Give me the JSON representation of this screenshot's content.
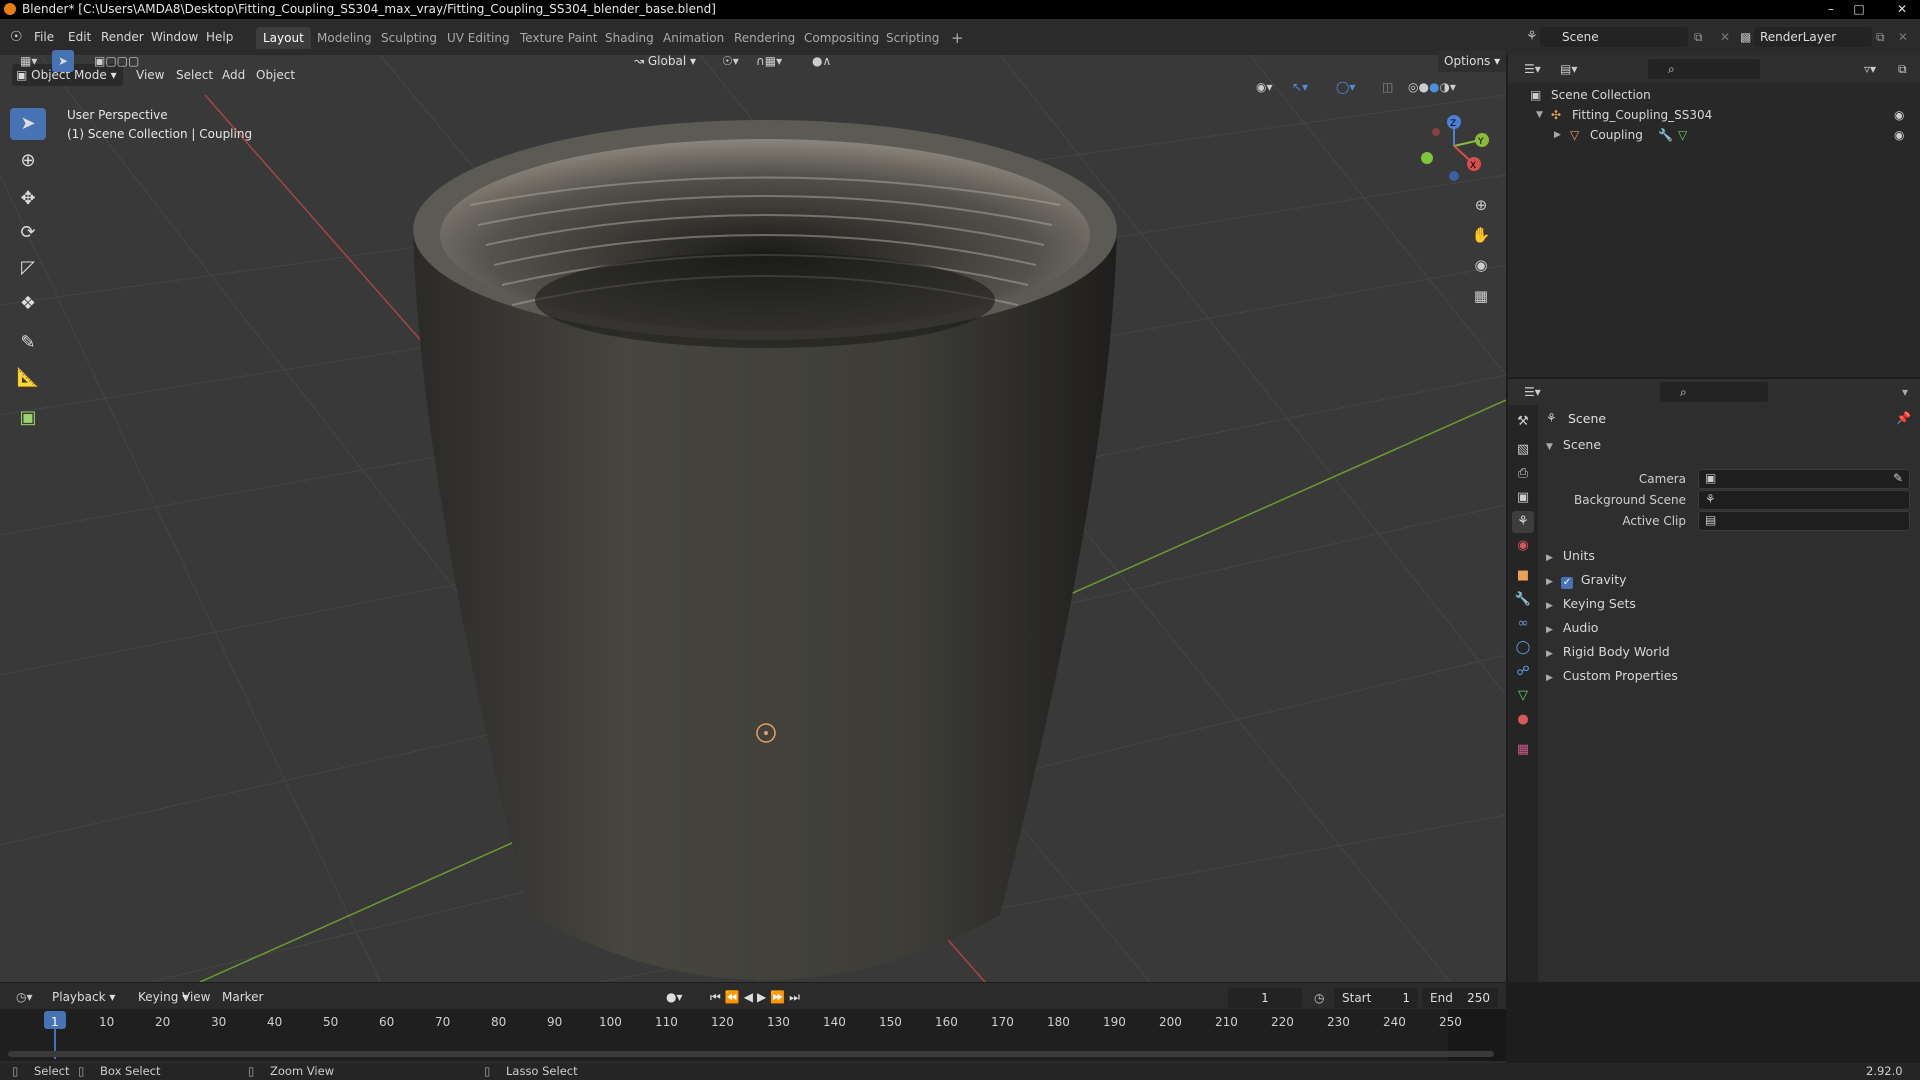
{
  "window": {
    "title": "Blender* [C:\\Users\\AMDA8\\Desktop\\Fitting_Coupling_SS304_max_vray/Fitting_Coupling_SS304_blender_base.blend]"
  },
  "menu": [
    "File",
    "Edit",
    "Render",
    "Window",
    "Help"
  ],
  "workspaces": [
    "Layout",
    "Modeling",
    "Sculpting",
    "UV Editing",
    "Texture Paint",
    "Shading",
    "Animation",
    "Rendering",
    "Compositing",
    "Scripting"
  ],
  "scene_field": "Scene",
  "renderlayer_field": "RenderLayer",
  "viewport": {
    "mode": "Object Mode",
    "header_menu": [
      "View",
      "Select",
      "Add",
      "Object"
    ],
    "transform": "Global",
    "options": "Options",
    "overlay_line1": "User Perspective",
    "overlay_line2": "(1) Scene Collection | Coupling",
    "gizmo": {
      "z": "Z",
      "y": "Y",
      "x": "X"
    }
  },
  "outliner": {
    "root": "Scene Collection",
    "collection": "Fitting_Coupling_SS304",
    "object": "Coupling"
  },
  "properties": {
    "header": "Scene",
    "panel_title": "Scene",
    "fields": {
      "camera": "Camera",
      "background_scene": "Background Scene",
      "active_clip": "Active Clip"
    },
    "panels": [
      "Units",
      "Gravity",
      "Keying Sets",
      "Audio",
      "Rigid Body World",
      "Custom Properties"
    ]
  },
  "timeline": {
    "menu": [
      "Playback",
      "Keying",
      "View",
      "Marker"
    ],
    "current_frame": "1",
    "start_label": "Start",
    "start_value": "1",
    "end_label": "End",
    "end_value": "250",
    "ticks": [
      "1",
      "10",
      "20",
      "30",
      "40",
      "50",
      "60",
      "70",
      "80",
      "90",
      "100",
      "110",
      "120",
      "130",
      "140",
      "150",
      "160",
      "170",
      "180",
      "190",
      "200",
      "210",
      "220",
      "230",
      "240",
      "250"
    ]
  },
  "status": {
    "select": "Select",
    "box_select": "Box Select",
    "zoom_view": "Zoom View",
    "lasso_select": "Lasso Select",
    "version": "2.92.0"
  }
}
